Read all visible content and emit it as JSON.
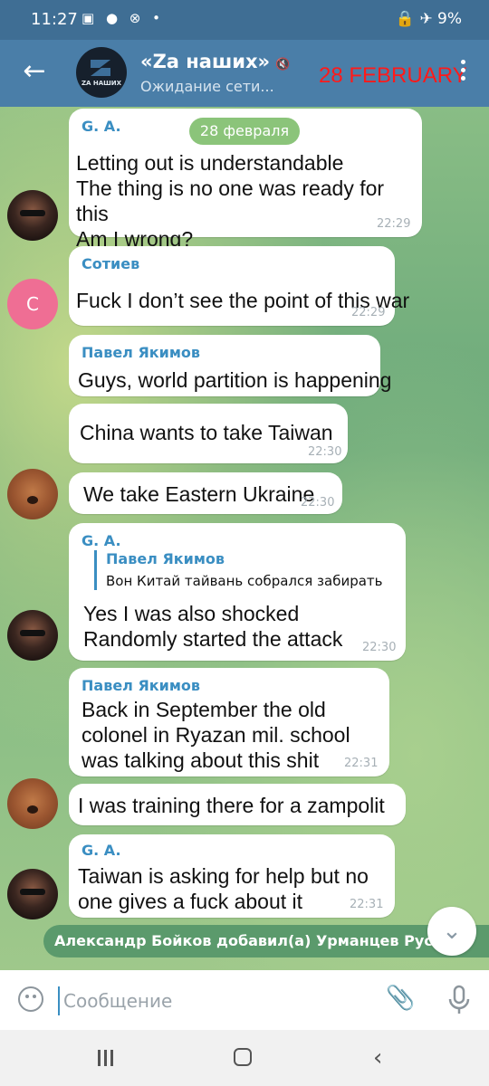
{
  "status_bar": {
    "time": "11:27",
    "notif_icons": "▣ ● ⊗ •",
    "right": "🔒 ✈ 9%"
  },
  "header": {
    "back_icon": "←",
    "avatar_label": "ZA НАШИХ",
    "title": "«Zа наших»",
    "mute_icon": "🔇",
    "status": "Ожидание сети...",
    "date_overlay": "28 FEBRUARY"
  },
  "chat": {
    "date_pill": "28 февраля",
    "messages": [
      {
        "sender": "G. A.",
        "text": "Letting out is understandable\nThe thing is no one was ready for this\nAm I wrong?",
        "time": "22:29"
      },
      {
        "sender": "Сотиев",
        "text": "Fuck I don’t see the point of this war",
        "time": "22:29"
      },
      {
        "sender": "Павел Якимов",
        "text": "Guys, world partition is happening",
        "time": ""
      },
      {
        "sender": "",
        "text": "China wants to take Taiwan",
        "time": "22:30"
      },
      {
        "sender": "",
        "text": "We take Eastern Ukraine",
        "time": "22:30"
      },
      {
        "sender": "G. A.",
        "reply_name": "Павел Якимов",
        "reply_text": "Вон Китай тайвань собрался забирать",
        "text": "Yes I was also shocked\nRandomly started the attack",
        "time": "22:30"
      },
      {
        "sender": "Павел Якимов",
        "text": "Back in September the old\ncolonel in Ryazan mil. school\nwas talking about this shit",
        "time": "22:31"
      },
      {
        "sender": "",
        "text": "I was training there for a zampolit",
        "time": ""
      },
      {
        "sender": "G. A.",
        "text": "Taiwan is asking for help but no\none gives a fuck about it",
        "time": "22:31"
      }
    ],
    "avatar_c_letter": "C",
    "service_message": "Александр Бойков добавил(а) Урманцев Руслан",
    "scroll_down_icon": "⌄"
  },
  "input": {
    "placeholder": "Сообщение",
    "attach_icon": "📎"
  },
  "nav": {
    "back_icon": "‹"
  }
}
